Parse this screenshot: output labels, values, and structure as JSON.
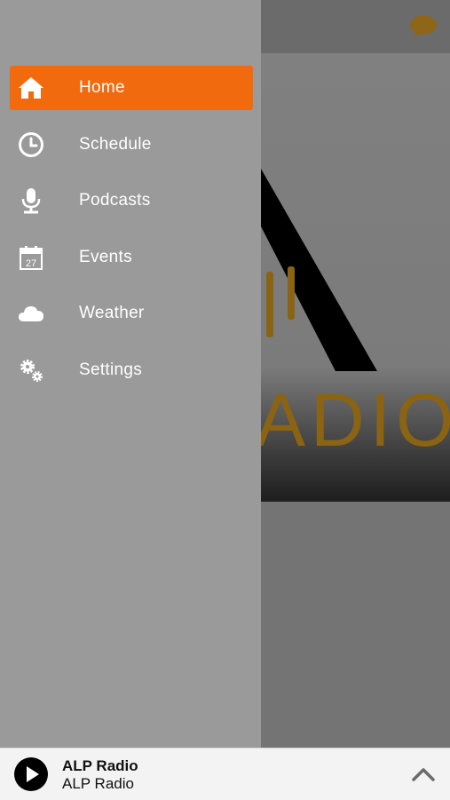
{
  "accent_color": "#f26a0e",
  "header": {
    "chat_icon": "chat-bubble-icon"
  },
  "hero": {
    "logo_text": "ADIO"
  },
  "menu": {
    "items": [
      {
        "label": "Home",
        "icon": "home-icon",
        "active": true
      },
      {
        "label": "Schedule",
        "icon": "clock-icon",
        "active": false
      },
      {
        "label": "Podcasts",
        "icon": "microphone-icon",
        "active": false
      },
      {
        "label": "Events",
        "icon": "calendar-icon",
        "calendar_day": "27",
        "active": false
      },
      {
        "label": "Weather",
        "icon": "cloud-icon",
        "active": false
      },
      {
        "label": "Settings",
        "icon": "gears-icon",
        "active": false
      }
    ]
  },
  "player": {
    "title": "ALP Radio",
    "subtitle": "ALP Radio",
    "play_icon": "play-icon",
    "expand_icon": "chevron-up-icon"
  }
}
